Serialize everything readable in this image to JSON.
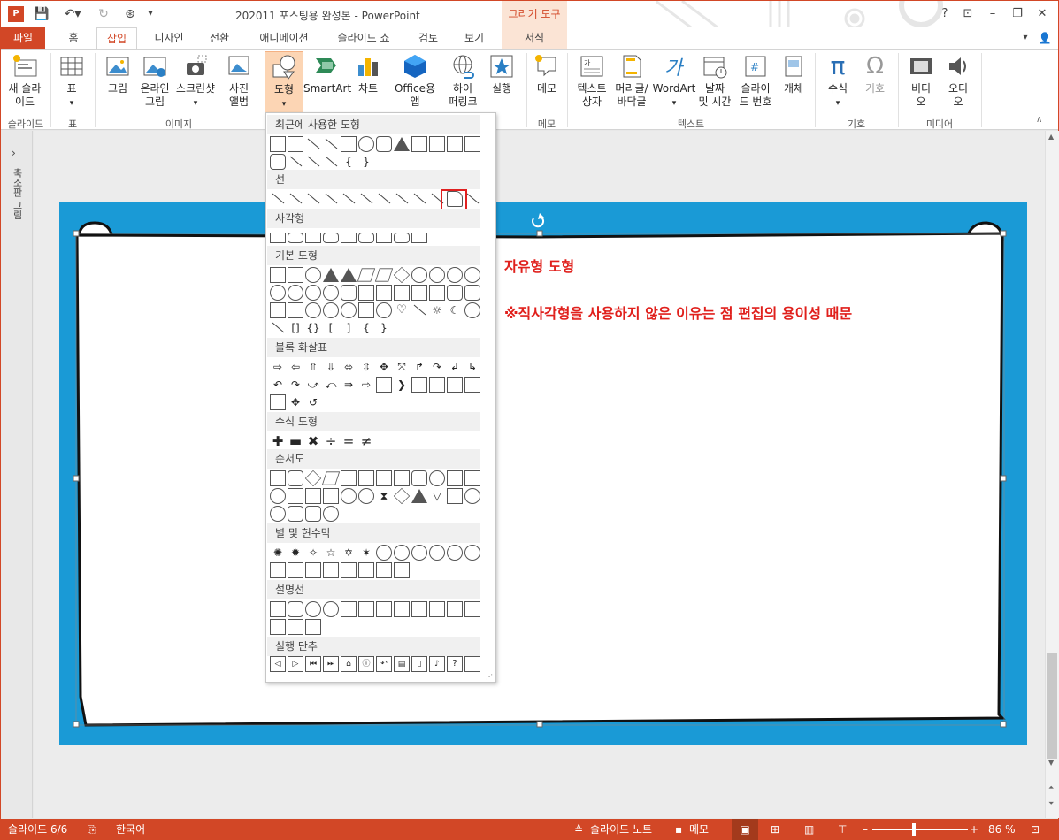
{
  "titlebar": {
    "logo": "P",
    "title": "202011 포스팅용 완성본 - PowerPoint",
    "context_tool": "그리기 도구",
    "help": "?",
    "user_icon": "user-icon"
  },
  "tabs": {
    "file": "파일",
    "home": "홈",
    "insert": "삽입",
    "design": "디자인",
    "transitions": "전환",
    "animations": "애니메이션",
    "slideshow": "슬라이드 쇼",
    "review": "검토",
    "view": "보기",
    "format": "서식"
  },
  "ribbon": {
    "new_slide": "새 슬라\n이드",
    "table": "표",
    "picture": "그림",
    "online_picture": "온라인\n그림",
    "screenshot": "스크린샷",
    "photo_album": "사진\n앨범",
    "shapes": "도형",
    "smartart": "SmartArt",
    "chart": "차트",
    "office_apps": "Office용\n앱",
    "hyperlink": "하이\n퍼링크",
    "action": "실행",
    "comment": "메모",
    "textbox": "텍스트\n상자",
    "header_footer": "머리글/\n바닥글",
    "wordart": "WordArt",
    "datetime": "날짜\n및 시간",
    "slide_number": "슬라이\n드 번호",
    "object": "개체",
    "equation": "수식",
    "symbol": "기호",
    "video": "비디\n오",
    "audio": "오디\n오",
    "groups": {
      "slides": "슬라이드",
      "tables": "표",
      "images": "이미지",
      "comments": "메모",
      "text": "텍스트",
      "symbols": "기호",
      "media": "미디어"
    }
  },
  "left_panel": {
    "label": "축소판 그림",
    "toggle": "›"
  },
  "slide": {
    "title": "자유형 도형",
    "note": "※직사각형을 사용하지 않은 이유는 점 편집의 용이성 때문",
    "text_color": "#e0201c",
    "bg_color": "#1a9ad6"
  },
  "shapes_menu": {
    "recent": "최근에 사용한 도형",
    "lines": "선",
    "rectangles": "사각형",
    "basic": "기본 도형",
    "block_arrows": "블록 화살표",
    "equation": "수식 도형",
    "flowchart": "순서도",
    "stars": "별 및 현수막",
    "callouts": "설명선",
    "action_buttons": "실행 단추"
  },
  "status": {
    "slide": "슬라이드 6/6",
    "language": "한국어",
    "notes": "슬라이드 노트",
    "comments": "메모",
    "zoom": "86 %"
  },
  "colors": {
    "accent": "#d24726",
    "highlight": "#fcd5b4",
    "blue": "#1a9ad6"
  }
}
